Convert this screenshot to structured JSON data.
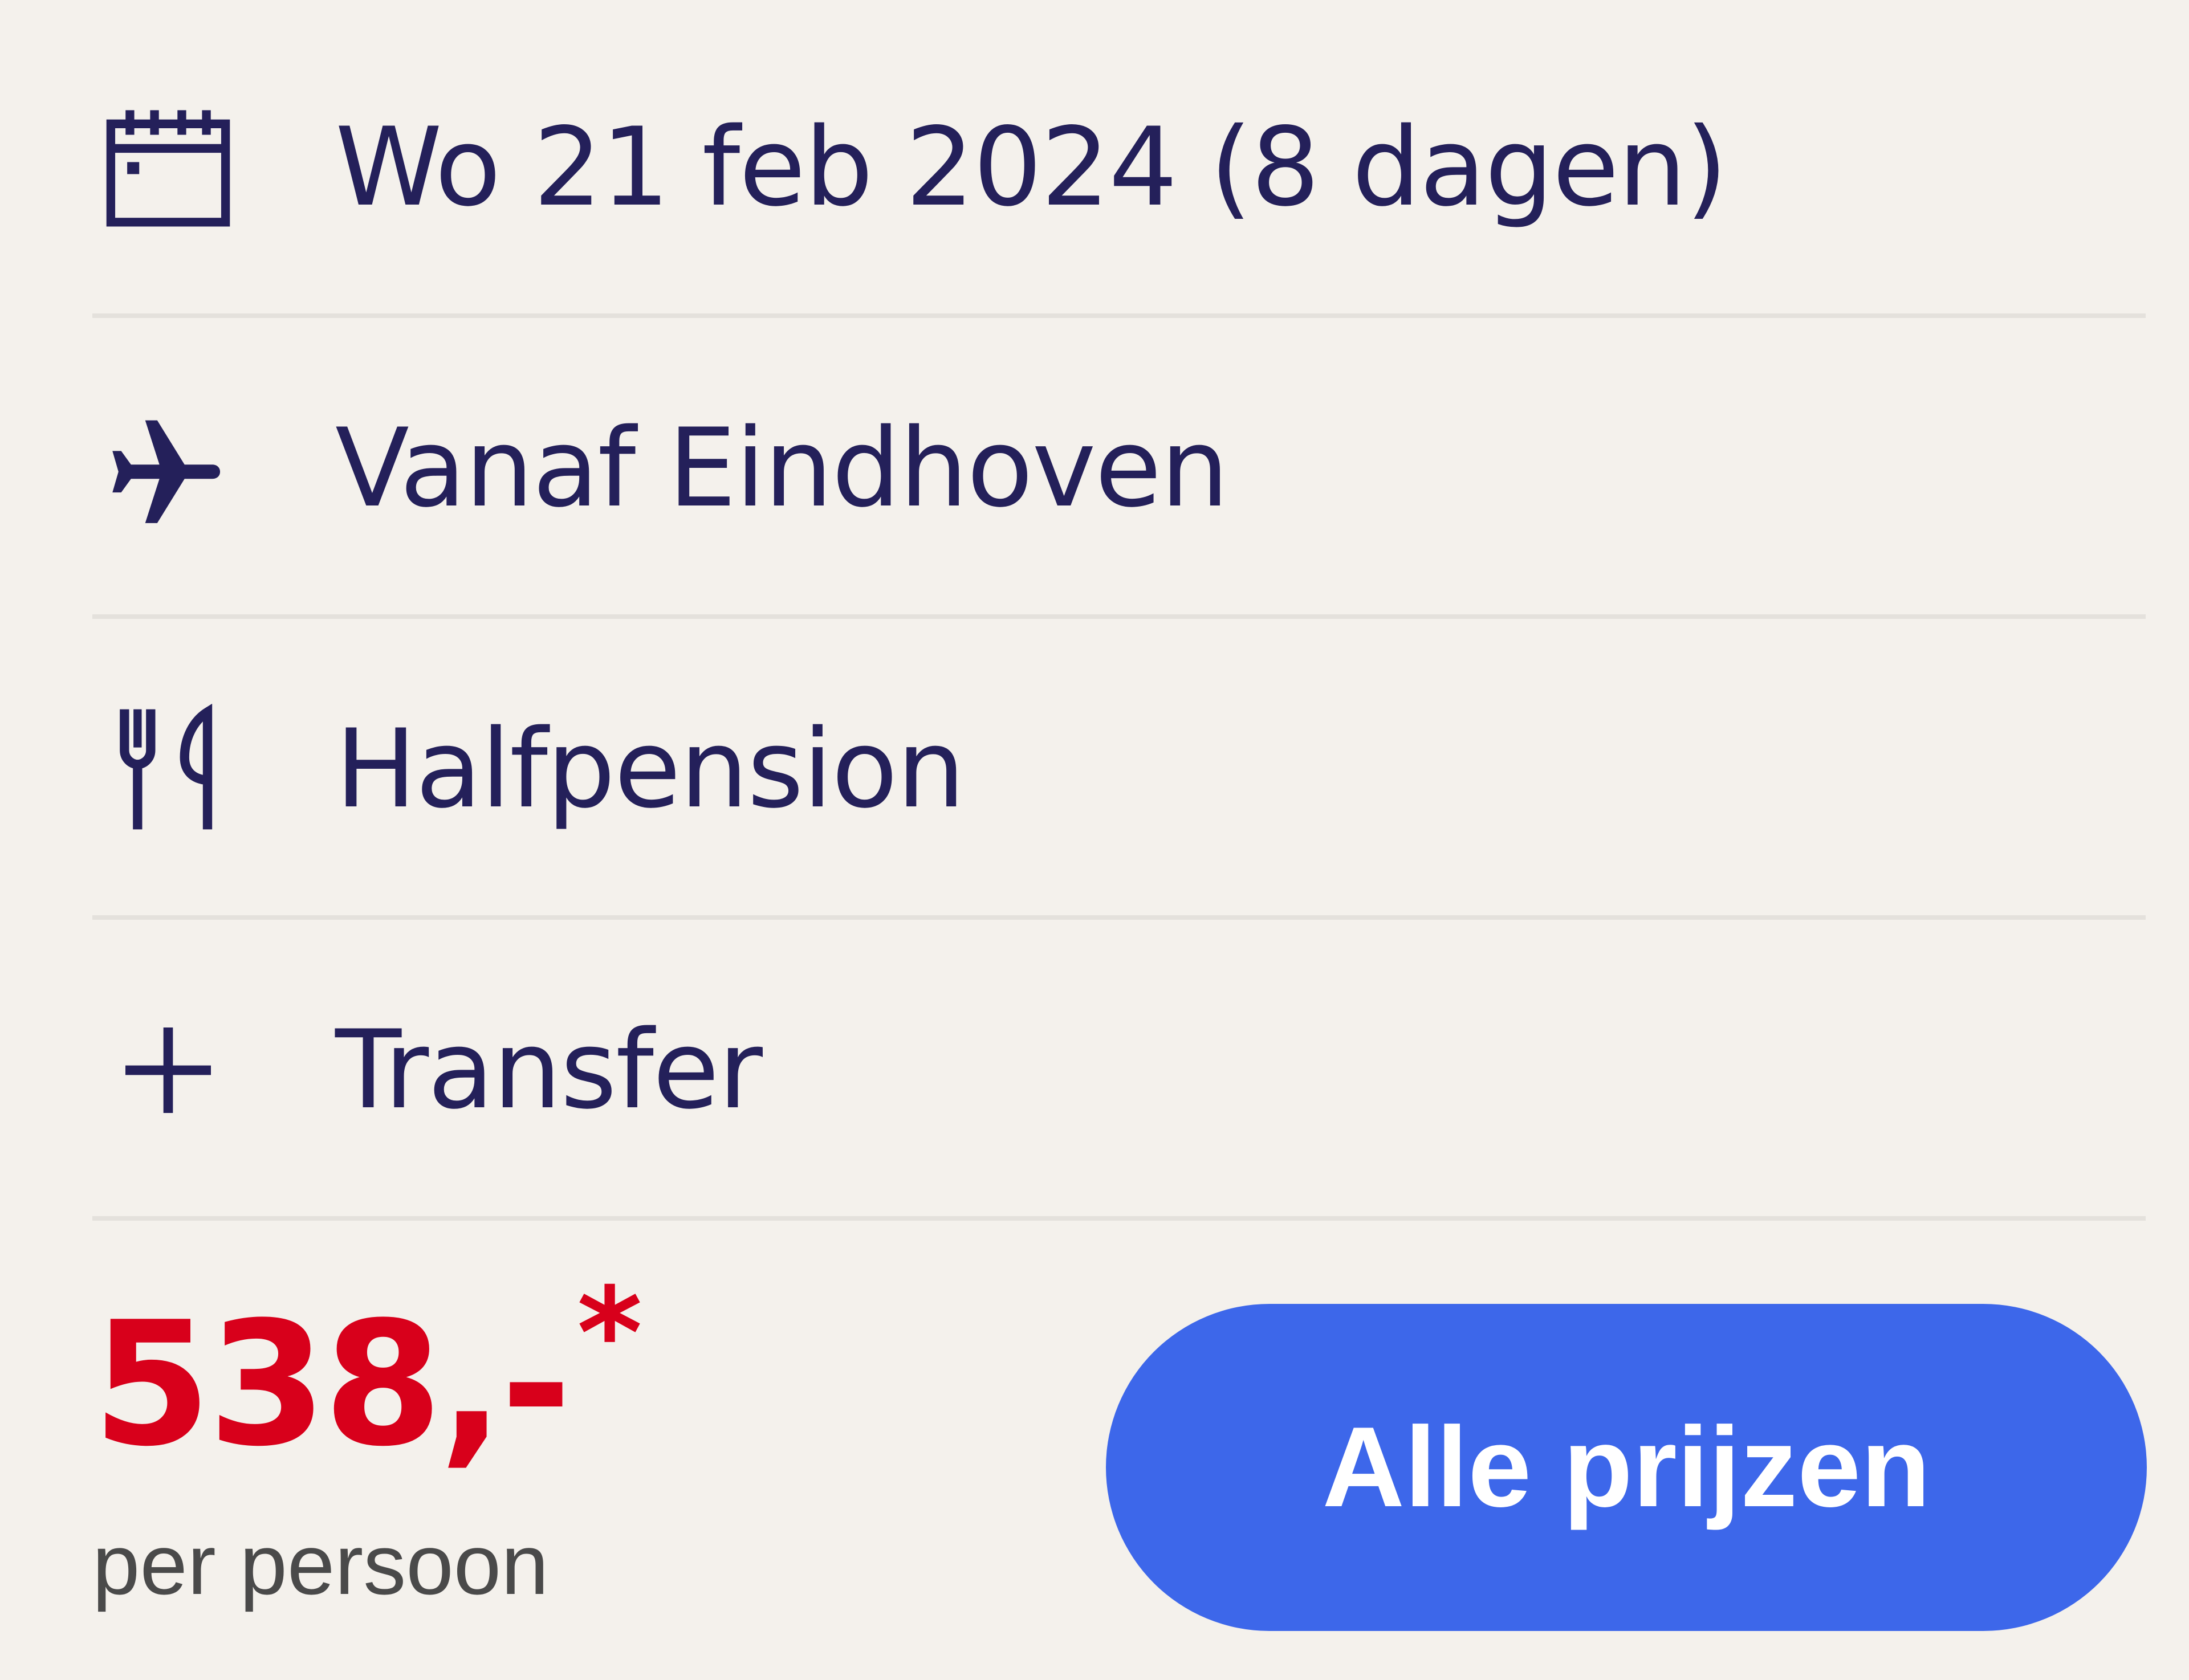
{
  "details": [
    {
      "icon": "calendar-icon",
      "label": "Wo 21 feb 2024 (8 dagen)"
    },
    {
      "icon": "plane-icon",
      "label": "Vanaf Eindhoven"
    },
    {
      "icon": "fork-knife-icon",
      "label": "Halfpension"
    },
    {
      "icon": "plus-icon",
      "label": "Transfer"
    }
  ],
  "price": {
    "amount": "538,-",
    "footnote_mark": "*",
    "unit": "per persoon"
  },
  "cta": {
    "label": "Alle prijzen"
  },
  "colors": {
    "background": "#f4f1ec",
    "text": "#24205a",
    "price": "#d8001b",
    "button": "#3d67ea",
    "divider": "#e4e1dc"
  }
}
